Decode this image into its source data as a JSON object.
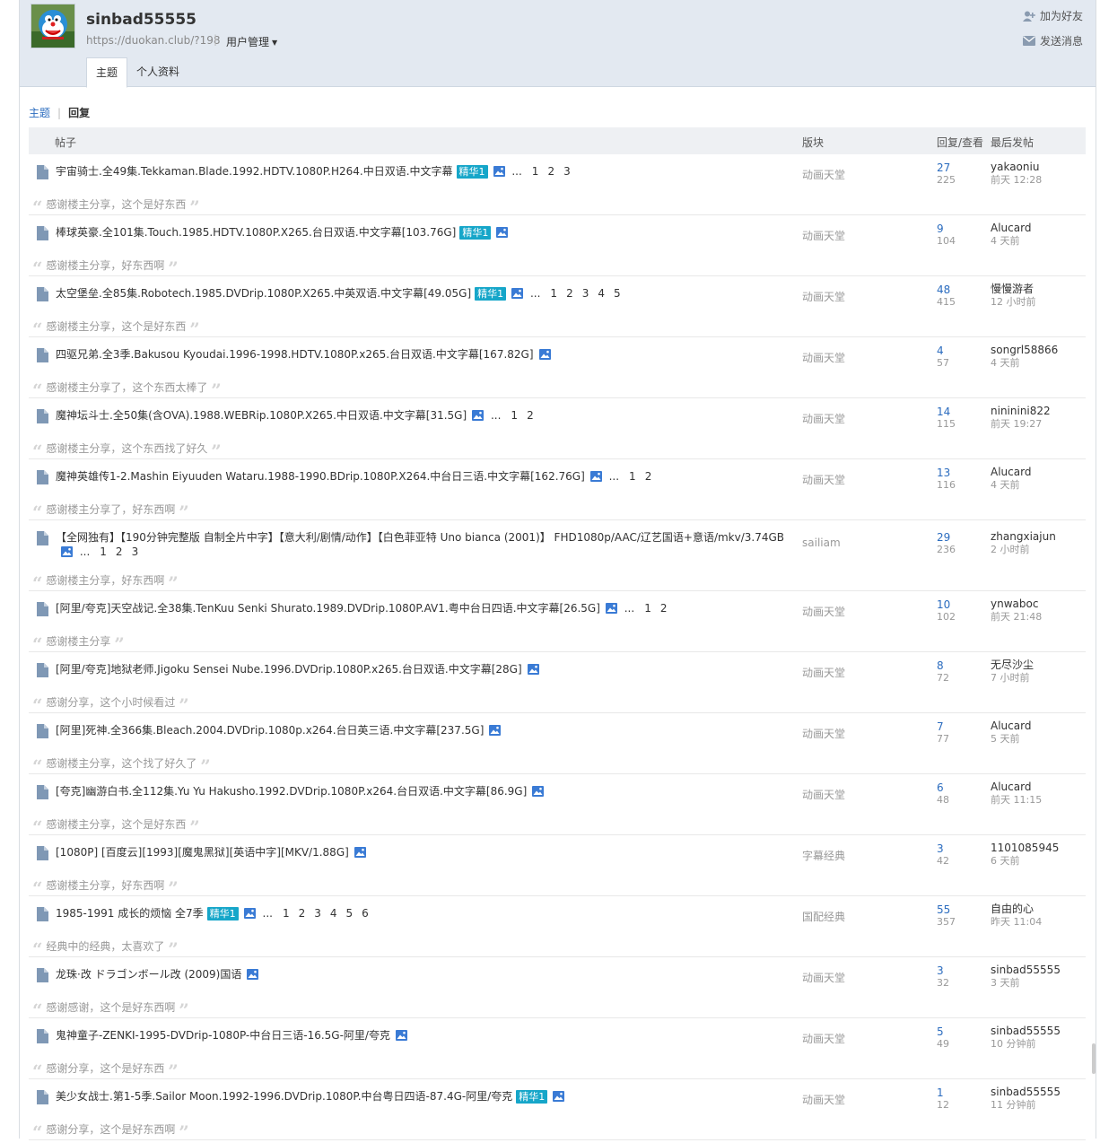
{
  "profile": {
    "username": "sinbad55555",
    "url": "https://duokan.club/?198",
    "user_mgmt": "用户管理",
    "add_friend": "加为好友",
    "send_message": "发送消息"
  },
  "tabs": [
    {
      "label": "主题",
      "active": true
    },
    {
      "label": "个人资料",
      "active": false
    }
  ],
  "subnav": {
    "topics": "主题",
    "replies": "回复"
  },
  "table_headers": {
    "post": "帖子",
    "forum": "版块",
    "stats": "回复/查看",
    "last": "最后发帖"
  },
  "colors": {
    "accent": "#2b6cbf",
    "badge": "#16a6c9",
    "header_bg": "#e3e9f1"
  },
  "rows": [
    {
      "title": "宇宙骑士.全49集.Tekkaman.Blade.1992.HDTV.1080P.H264.中日双语.中文字幕",
      "badge": "精华1",
      "pages": [
        "1",
        "2",
        "3"
      ],
      "quote": "感谢楼主分享，这个是好东西",
      "forum": "动画天堂",
      "replies": "27",
      "views": "225",
      "last_user": "yakaoniu",
      "last_time": "前天 12:28"
    },
    {
      "title": "棒球英豪.全101集.Touch.1985.HDTV.1080P.X265.台日双语.中文字幕[103.76G]",
      "badge": "精华1",
      "pages": [],
      "quote": "感谢楼主分享，好东西啊",
      "forum": "动画天堂",
      "replies": "9",
      "views": "104",
      "last_user": "Alucard",
      "last_time": "4 天前"
    },
    {
      "title": "太空堡垒.全85集.Robotech.1985.DVDrip.1080P.X265.中英双语.中文字幕[49.05G]",
      "badge": "精华1",
      "pages": [
        "1",
        "2",
        "3",
        "4",
        "5"
      ],
      "quote": "感谢楼主分享，这个是好东西",
      "forum": "动画天堂",
      "replies": "48",
      "views": "415",
      "last_user": "慢慢游者",
      "last_time": "12 小时前"
    },
    {
      "title": "四驱兄弟.全3季.Bakusou Kyoudai.1996-1998.HDTV.1080P.x265.台日双语.中文字幕[167.82G]",
      "badge": "",
      "pages": [],
      "quote": "感谢楼主分享了，这个东西太棒了",
      "forum": "动画天堂",
      "replies": "4",
      "views": "57",
      "last_user": "songrl58866",
      "last_time": "4 天前"
    },
    {
      "title": "魔神坛斗士.全50集(含OVA).1988.WEBRip.1080P.X265.中日双语.中文字幕[31.5G]",
      "badge": "",
      "pages": [
        "1",
        "2"
      ],
      "quote": "感谢楼主分享，这个东西找了好久",
      "forum": "动画天堂",
      "replies": "14",
      "views": "115",
      "last_user": "nininini822",
      "last_time": "前天 19:27"
    },
    {
      "title": "魔神英雄传1-2.Mashin Eiyuuden Wataru.1988-1990.BDrip.1080P.X264.中台日三语.中文字幕[162.76G]",
      "badge": "",
      "pages": [
        "1",
        "2"
      ],
      "quote": "感谢楼主分享了，好东西啊",
      "forum": "动画天堂",
      "replies": "13",
      "views": "116",
      "last_user": "Alucard",
      "last_time": "4 天前"
    },
    {
      "title": "【全网独有】【190分钟完整版 自制全片中字】【意大利/剧情/动作】【白色菲亚特 Uno bianca (2001)】 FHD1080p/AAC/辽艺国语+意语/mkv/3.74GB",
      "badge": "",
      "pages": [
        "1",
        "2",
        "3"
      ],
      "quote": "感谢楼主分享，好东西啊",
      "forum": "sailiam",
      "replies": "29",
      "views": "236",
      "last_user": "zhangxiajun",
      "last_time": "2 小时前",
      "tall": true
    },
    {
      "title": "[阿里/夸克]天空战记.全38集.TenKuu Senki Shurato.1989.DVDrip.1080P.AV1.粤中台日四语.中文字幕[26.5G]",
      "badge": "",
      "pages": [
        "1",
        "2"
      ],
      "quote": "感谢楼主分享",
      "forum": "动画天堂",
      "replies": "10",
      "views": "102",
      "last_user": "ynwaboc",
      "last_time": "前天 21:48"
    },
    {
      "title": "[阿里/夸克]地狱老师.Jigoku Sensei Nube.1996.DVDrip.1080P.x265.台日双语.中文字幕[28G]",
      "badge": "",
      "pages": [],
      "quote": "感谢分享，这个小时候看过",
      "forum": "动画天堂",
      "replies": "8",
      "views": "72",
      "last_user": "无尽沙尘",
      "last_time": "7 小时前"
    },
    {
      "title": "[阿里]死神.全366集.Bleach.2004.DVDrip.1080p.x264.台日英三语.中文字幕[237.5G]",
      "badge": "",
      "pages": [],
      "quote": "感谢楼主分享，这个找了好久了",
      "forum": "动画天堂",
      "replies": "7",
      "views": "77",
      "last_user": "Alucard",
      "last_time": "5 天前"
    },
    {
      "title": "[夸克]幽游白书.全112集.Yu Yu Hakusho.1992.DVDrip.1080P.x264.台日双语.中文字幕[86.9G]",
      "badge": "",
      "pages": [],
      "quote": "感谢楼主分享，这个是好东西",
      "forum": "动画天堂",
      "replies": "6",
      "views": "48",
      "last_user": "Alucard",
      "last_time": "前天 11:15"
    },
    {
      "title": "[1080P] [百度云][1993][魔鬼黑狱][英语中字][MKV/1.88G]",
      "badge": "",
      "pages": [],
      "quote": "感谢楼主分享，好东西啊",
      "forum": "字幕经典",
      "replies": "3",
      "views": "42",
      "last_user": "1101085945",
      "last_time": "6 天前"
    },
    {
      "title": "1985-1991 成长的烦恼 全7季",
      "badge": "精华1",
      "pages": [
        "1",
        "2",
        "3",
        "4",
        "5",
        "6"
      ],
      "quote": "经典中的经典，太喜欢了",
      "forum": "国配经典",
      "replies": "55",
      "views": "357",
      "last_user": "自由的心",
      "last_time": "昨天 11:04"
    },
    {
      "title": "龙珠·改 ドラゴンボール改 (2009)国语",
      "badge": "",
      "pages": [],
      "quote": "感谢感谢，这个是好东西啊",
      "forum": "动画天堂",
      "replies": "3",
      "views": "32",
      "last_user": "sinbad55555",
      "last_time": "3 天前"
    },
    {
      "title": "鬼神童子-ZENKI-1995-DVDrip-1080P-中台日三语-16.5G-阿里/夸克",
      "badge": "",
      "pages": [],
      "quote": "感谢分享，这个是好东西",
      "forum": "动画天堂",
      "replies": "5",
      "views": "49",
      "last_user": "sinbad55555",
      "last_time": "10 分钟前"
    },
    {
      "title": "美少女战士.第1-5季.Sailor Moon.1992-1996.DVDrip.1080P.中台粤日四语-87.4G-阿里/夸克",
      "badge": "精华1",
      "pages": [],
      "quote": "感谢分享，这个是好东西啊",
      "forum": "动画天堂",
      "replies": "1",
      "views": "12",
      "last_user": "sinbad55555",
      "last_time": "11 分钟前"
    }
  ]
}
